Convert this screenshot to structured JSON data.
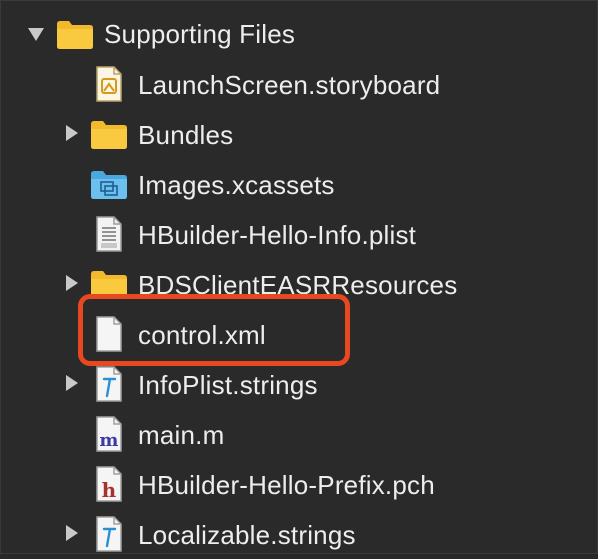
{
  "navigator": {
    "group": {
      "label": "Supporting Files",
      "expanded": true,
      "icon": "folder-icon"
    },
    "items": [
      {
        "label": "LaunchScreen.storyboard",
        "icon": "storyboard-file-icon",
        "disclosure": false
      },
      {
        "label": "Bundles",
        "icon": "folder-icon",
        "disclosure": true
      },
      {
        "label": "Images.xcassets",
        "icon": "asset-catalog-icon",
        "disclosure": false
      },
      {
        "label": "HBuilder-Hello-Info.plist",
        "icon": "plist-file-icon",
        "disclosure": false
      },
      {
        "label": "BDSClientEASRResources",
        "icon": "folder-icon",
        "disclosure": true
      },
      {
        "label": "control.xml",
        "icon": "blank-file-icon",
        "disclosure": false,
        "highlighted": true
      },
      {
        "label": "InfoPlist.strings",
        "icon": "strings-file-icon",
        "disclosure": true
      },
      {
        "label": "main.m",
        "icon": "objc-m-file-icon",
        "disclosure": false
      },
      {
        "label": "HBuilder-Hello-Prefix.pch",
        "icon": "header-h-file-icon",
        "disclosure": false
      },
      {
        "label": "Localizable.strings",
        "icon": "strings-file-icon",
        "disclosure": true
      }
    ]
  },
  "colors": {
    "background": "#2a2a2a",
    "text": "#ededed",
    "folder": "#f7c136",
    "highlight": "#e8481f",
    "disclosure": "#c9c9c9"
  }
}
